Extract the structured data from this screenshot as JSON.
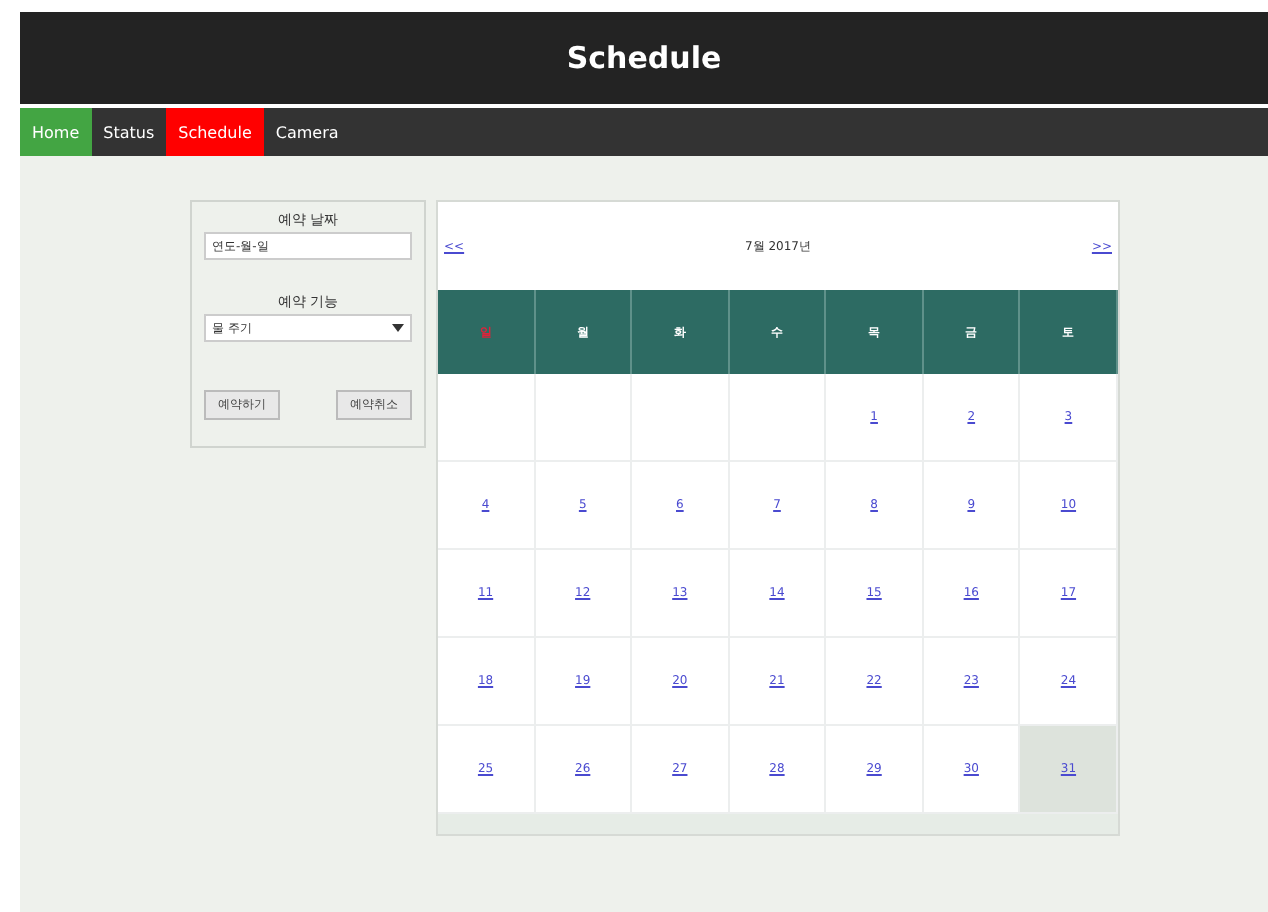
{
  "header": {
    "title": "Schedule"
  },
  "nav": [
    {
      "label": "Home",
      "color": "#43a543"
    },
    {
      "label": "Status",
      "color": "#333333"
    },
    {
      "label": "Schedule",
      "color": "#ff0000"
    },
    {
      "label": "Camera",
      "color": "#333333"
    }
  ],
  "form": {
    "date_label": "예약 날짜",
    "date_placeholder": "연도-월-일",
    "function_label": "예약 기능",
    "function_value": "물 주기",
    "buttons": [
      "예약하기",
      "예약취소"
    ]
  },
  "calendar": {
    "prev": "<<",
    "title": "7월 2017년",
    "next": ">>",
    "weekdays": [
      {
        "label": "일",
        "color": "#e0223a"
      },
      {
        "label": "월",
        "color": "#ffffff"
      },
      {
        "label": "화",
        "color": "#ffffff"
      },
      {
        "label": "수",
        "color": "#ffffff"
      },
      {
        "label": "목",
        "color": "#ffffff"
      },
      {
        "label": "금",
        "color": "#ffffff"
      },
      {
        "label": "토",
        "color": "#ffffff"
      }
    ],
    "weeks": [
      [
        {
          "kind": "empty"
        },
        {
          "kind": "empty"
        },
        {
          "kind": "empty"
        },
        {
          "kind": "empty"
        },
        {
          "day": "1",
          "selected": false
        },
        {
          "day": "2",
          "selected": false
        },
        {
          "day": "3",
          "selected": false
        }
      ],
      [
        {
          "day": "4",
          "selected": false
        },
        {
          "day": "5",
          "selected": false
        },
        {
          "day": "6",
          "selected": false
        },
        {
          "day": "7",
          "selected": false
        },
        {
          "day": "8",
          "selected": false
        },
        {
          "day": "9",
          "selected": false
        },
        {
          "day": "10",
          "selected": false
        }
      ],
      [
        {
          "day": "11",
          "selected": false
        },
        {
          "day": "12",
          "selected": false
        },
        {
          "day": "13",
          "selected": false
        },
        {
          "day": "14",
          "selected": false
        },
        {
          "day": "15",
          "selected": false
        },
        {
          "day": "16",
          "selected": false
        },
        {
          "day": "17",
          "selected": false
        }
      ],
      [
        {
          "day": "18",
          "selected": false
        },
        {
          "day": "19",
          "selected": false
        },
        {
          "day": "20",
          "selected": false
        },
        {
          "day": "21",
          "selected": false
        },
        {
          "day": "22",
          "selected": false
        },
        {
          "day": "23",
          "selected": false
        },
        {
          "day": "24",
          "selected": false
        }
      ],
      [
        {
          "day": "25",
          "selected": false
        },
        {
          "day": "26",
          "selected": false
        },
        {
          "day": "27",
          "selected": false
        },
        {
          "day": "28",
          "selected": false
        },
        {
          "day": "29",
          "selected": false
        },
        {
          "day": "30",
          "selected": false
        },
        {
          "day": "31",
          "selected": true
        }
      ]
    ]
  }
}
